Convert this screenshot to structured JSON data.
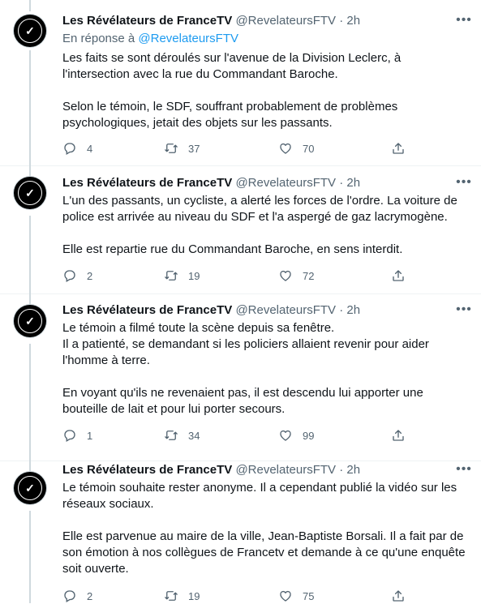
{
  "tweets": [
    {
      "author": "Les Révélateurs de FranceTV",
      "handle": "@RevelateursFTV",
      "time": "2h",
      "reply_prefix": "En réponse à ",
      "reply_handle": "@RevelateursFTV",
      "paragraphs": [
        "Les faits se sont déroulés sur l'avenue de la Division Leclerc, à l'intersection avec la rue du Commandant Baroche.",
        "Selon le témoin, le SDF, souffrant probablement de problèmes psychologiques, jetait des objets sur les passants."
      ],
      "replies": "4",
      "retweets": "37",
      "likes": "70"
    },
    {
      "author": "Les Révélateurs de FranceTV",
      "handle": "@RevelateursFTV",
      "time": "2h",
      "paragraphs": [
        "L'un des passants, un cycliste, a alerté les forces de l'ordre. La voiture de police est arrivée au niveau du SDF et l'a aspergé de gaz lacrymogène.",
        "Elle est repartie rue du Commandant Baroche, en sens interdit."
      ],
      "replies": "2",
      "retweets": "19",
      "likes": "72"
    },
    {
      "author": "Les Révélateurs de FranceTV",
      "handle": "@RevelateursFTV",
      "time": "2h",
      "paragraphs": [
        "Le témoin a filmé toute la scène depuis sa fenêtre.\nIl a patienté, se demandant si les policiers allaient revenir pour aider l'homme à terre.",
        "En voyant qu'ils ne revenaient pas, il est descendu lui apporter une bouteille de lait et pour lui porter secours."
      ],
      "replies": "1",
      "retweets": "34",
      "likes": "99"
    },
    {
      "author": "Les Révélateurs de FranceTV",
      "handle": "@RevelateursFTV",
      "time": "2h",
      "paragraphs": [
        "Le témoin souhaite rester anonyme. Il a cependant publié la vidéo sur les réseaux sociaux.",
        "Elle est parvenue au maire de la ville, Jean-Baptiste Borsali. Il a fait par de son émotion à nos collègues de Francetv et demande à ce qu'une enquête soit ouverte."
      ],
      "replies": "2",
      "retweets": "19",
      "likes": "75"
    }
  ],
  "separator": " · ",
  "icons": {
    "avatar": "checkmark-logo",
    "more": "more-icon",
    "reply": "reply-icon",
    "retweet": "retweet-icon",
    "like": "heart-icon",
    "share": "share-icon"
  },
  "colors": {
    "text": "#0f1419",
    "muted": "#536471",
    "link": "#1d9bf0",
    "thread_line": "#cfd9de",
    "divider": "#eff3f4"
  }
}
